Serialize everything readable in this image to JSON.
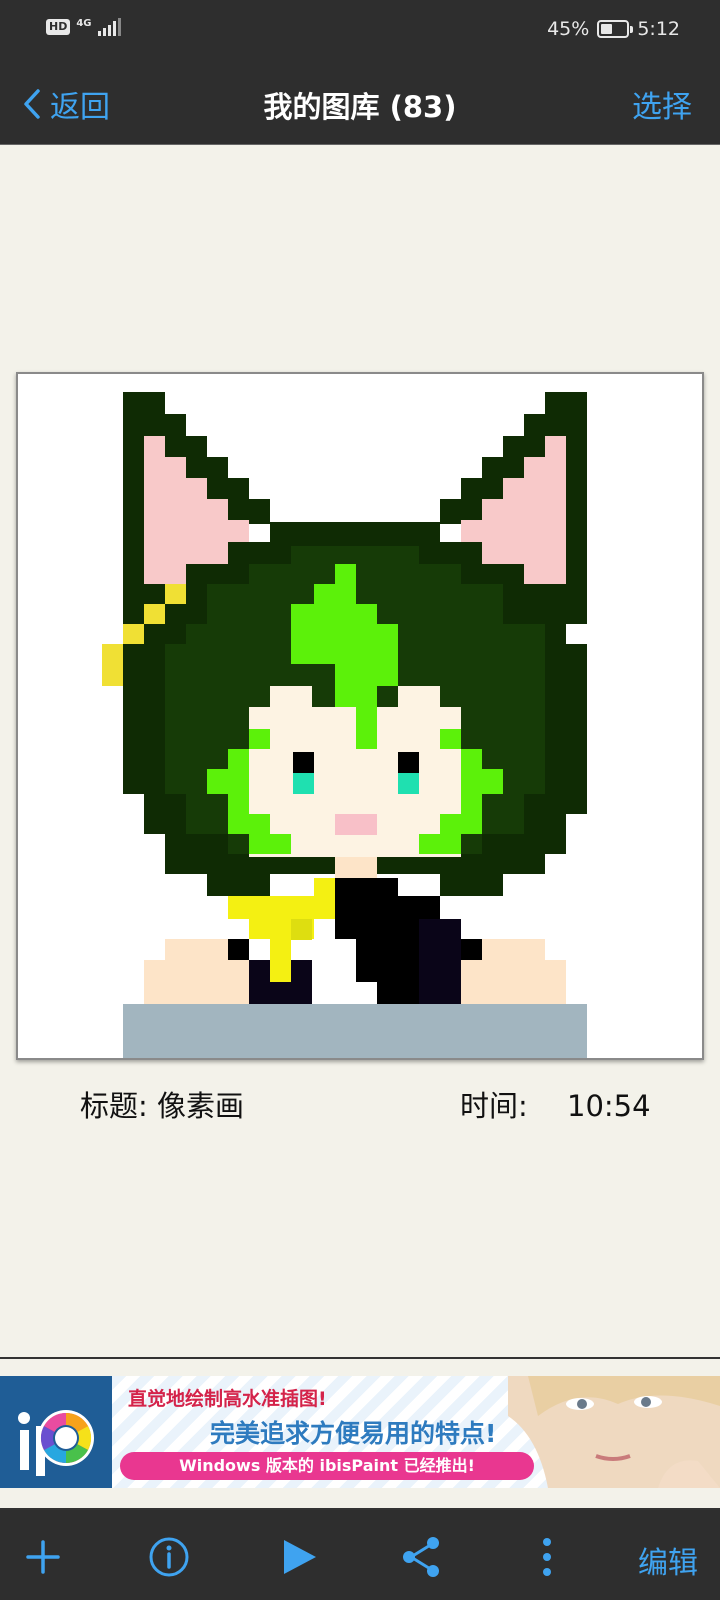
{
  "status_bar": {
    "hd_label": "HD",
    "network_label": "4G",
    "battery_percent": "45%",
    "battery_level": 0.45,
    "time": "5:12"
  },
  "nav": {
    "back_label": "返回",
    "title": "我的图库 (83)",
    "select_label": "选择"
  },
  "artwork": {
    "title_label": "标题:",
    "title_value": "像素画",
    "time_label": "时间:",
    "time_value": "10:54"
  },
  "ad": {
    "line1": "直觉地绘制高水准插图!",
    "line2": "完美追求方便易用的特点!",
    "pill": "Windows 版本的 ibisPaint 已经推出!"
  },
  "toolbar": {
    "edit_label": "编辑",
    "icons": [
      "plus-icon",
      "info-icon",
      "play-icon",
      "share-icon",
      "more-vertical-icon"
    ]
  },
  "colors": {
    "accent": "#3fa3f0",
    "bar_bg": "#2e2e2e",
    "page_bg": "#f3f2ea"
  }
}
